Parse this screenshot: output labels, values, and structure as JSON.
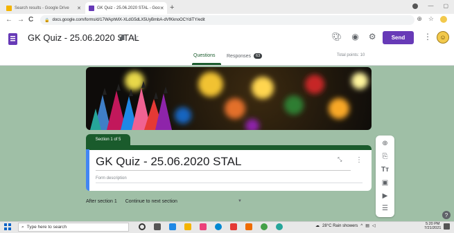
{
  "browser": {
    "tabs": [
      {
        "title": "Search results - Google Drive",
        "favicon_color": "#f4b400"
      },
      {
        "title": "GK Quiz - 25.06.2020 STAL - Goo",
        "favicon_color": "#673ab7"
      }
    ],
    "new_tab": "+",
    "url": "docs.google.com/forms/d/17WAphMX-XLdG5dLX5UyBmbA-dVfKknoOCYdiTY/edit",
    "nav": {
      "back": "←",
      "forward": "→",
      "reload": "C"
    }
  },
  "forms_header": {
    "title": "GK Quiz - 25.06.2020 STAL",
    "send_label": "Send",
    "accent_color": "#673ab7",
    "icons": [
      "palette-icon",
      "preview-eye-icon",
      "settings-gear-icon"
    ]
  },
  "tabs": {
    "questions": "Questions",
    "responses": "Responses",
    "responses_count": "63",
    "total_points": "Total points: 10"
  },
  "section": {
    "label": "Section 1 of 5",
    "title": "GK Quiz - 25.06.2020 STAL",
    "description_placeholder": "Form description",
    "theme_color": "#1a5b2c"
  },
  "after_section": {
    "label": "After section 1",
    "value": "Continue to next section"
  },
  "toolbar": {
    "icons": [
      "add-question-icon",
      "import-questions-icon",
      "add-title-icon",
      "add-image-icon",
      "add-video-icon",
      "add-section-icon"
    ]
  },
  "taskbar": {
    "search_placeholder": "Type here to search",
    "weather": "28°C Rain showers",
    "time": "5:20 PM",
    "date": "7/21/2021"
  }
}
